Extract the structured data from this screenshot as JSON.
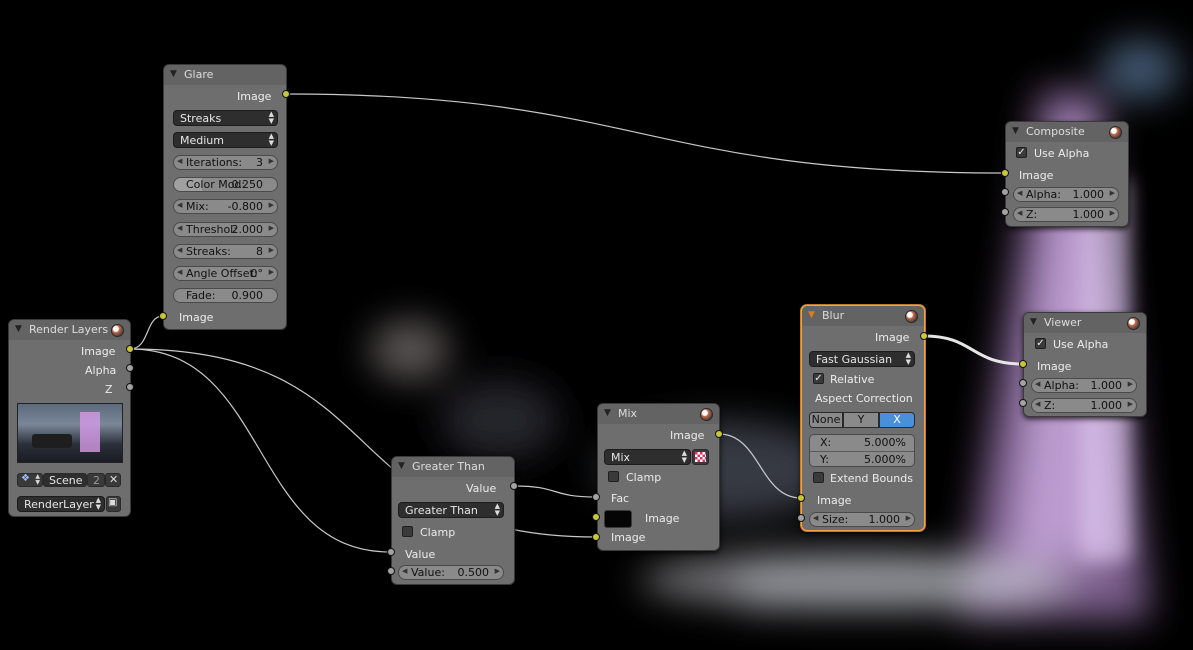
{
  "glare": {
    "title": "Glare",
    "output_label": "Image",
    "type": "Streaks",
    "quality": "Medium",
    "fields": [
      {
        "k": "Iterations:",
        "v": "3"
      },
      {
        "k": "Color Mod:",
        "v": "0.250"
      },
      {
        "k": "Mix:",
        "v": "-0.800"
      },
      {
        "k": "Threshol:",
        "v": "2.000"
      },
      {
        "k": "Streaks:",
        "v": "8"
      },
      {
        "k": "Angle Offset:",
        "v": "0°"
      },
      {
        "k": "Fade:",
        "v": "0.900"
      }
    ],
    "input_label": "Image"
  },
  "render_layers": {
    "title": "Render Layers",
    "outputs": [
      "Image",
      "Alpha",
      "Z"
    ],
    "scene": "Scene",
    "scene_users": "2",
    "layer": "RenderLayer"
  },
  "greater_than": {
    "title": "Greater Than",
    "output_label": "Value",
    "operation": "Greater Than",
    "clamp": "Clamp",
    "input_label": "Value",
    "value_k": "Value:",
    "value_v": "0.500"
  },
  "mix": {
    "title": "Mix",
    "output_label": "Image",
    "blend": "Mix",
    "clamp": "Clamp",
    "fac": "Fac",
    "image1": "Image",
    "image2": "Image"
  },
  "blur": {
    "title": "Blur",
    "output_label": "Image",
    "filter": "Fast Gaussian",
    "relative": "Relative",
    "aspect": "Aspect Correction",
    "aspect_opts": [
      "None",
      "Y",
      "X"
    ],
    "x_k": "X:",
    "x_v": "5.000%",
    "y_k": "Y:",
    "y_v": "5.000%",
    "extend": "Extend Bounds",
    "input_label": "Image",
    "size_k": "Size:",
    "size_v": "1.000"
  },
  "composite": {
    "title": "Composite",
    "use_alpha": "Use Alpha",
    "image": "Image",
    "alpha_k": "Alpha:",
    "alpha_v": "1.000",
    "z_k": "Z:",
    "z_v": "1.000"
  },
  "viewer": {
    "title": "Viewer",
    "use_alpha": "Use Alpha",
    "image": "Image",
    "alpha_k": "Alpha:",
    "alpha_v": "1.000",
    "z_k": "Z:",
    "z_v": "1.000"
  },
  "colors": {
    "socket_image": "#c8c63a",
    "socket_value": "#a3a3a3",
    "active_outline": "#f2a44a",
    "toggle_active": "#4a90d9"
  }
}
